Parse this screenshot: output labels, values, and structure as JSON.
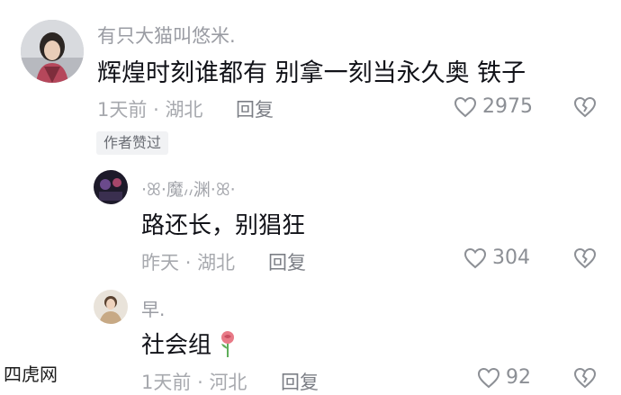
{
  "comments": [
    {
      "username": "有只大猫叫悠米.",
      "text": "辉煌时刻谁都有 别拿一刻当永久奥 铁子",
      "time": "1天前",
      "location": "湖北",
      "reply_label": "回复",
      "likes": "2975",
      "author_tag": "作者赞过"
    }
  ],
  "replies": [
    {
      "username": "·ꕤ·魔៸៸渊·ꕤ·",
      "text": "路还长，别猖狂",
      "time": "昨天",
      "location": "湖北",
      "reply_label": "回复",
      "likes": "304"
    },
    {
      "username": "早.",
      "text": "社会组",
      "time": "1天前",
      "location": "河北",
      "reply_label": "回复",
      "likes": "92"
    }
  ],
  "separator": "·",
  "watermark": "四虎网",
  "colors": {
    "accent_rose": "#e87a87",
    "leaf": "#5fae5a"
  }
}
